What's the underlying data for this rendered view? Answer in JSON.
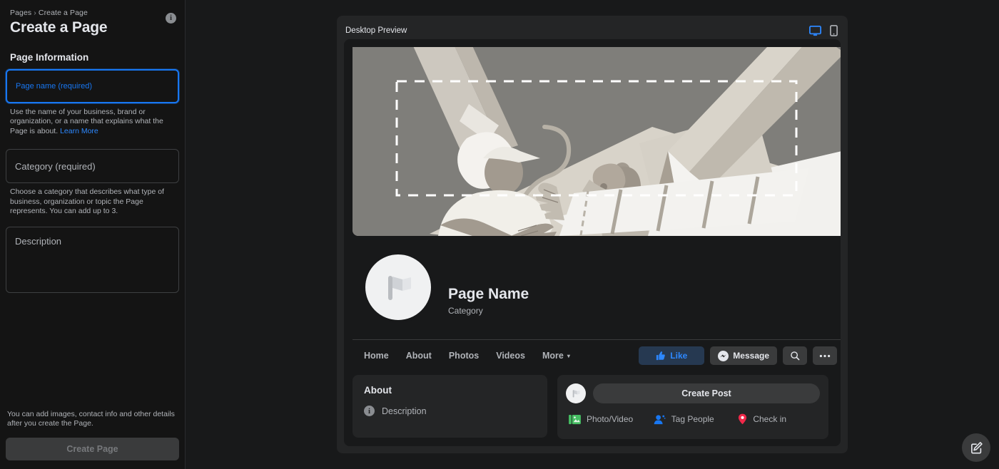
{
  "sidebar": {
    "breadcrumb": {
      "root": "Pages",
      "separator": "›",
      "current": "Create a Page"
    },
    "title": "Create a Page",
    "info_icon": "i",
    "section_title": "Page Information",
    "fields": [
      {
        "name": "page-name",
        "label": "Page name (required)",
        "value": "",
        "focused": true,
        "helper": "Use the name of your business, brand or organization, or a name that explains what the Page is about. ",
        "helper_link": "Learn More"
      },
      {
        "name": "category",
        "label": "Category (required)",
        "value": "",
        "focused": false,
        "helper": "Choose a category that describes what type of business, organization or topic the Page represents. You can add up to 3.",
        "helper_link": ""
      },
      {
        "name": "description",
        "label": "Description",
        "value": "",
        "focused": false,
        "helper": "",
        "helper_link": ""
      }
    ],
    "foot_note": "You can add images, contact info and other details after you create the Page.",
    "create_button": "Create Page"
  },
  "preview": {
    "title": "Desktop Preview",
    "devices": [
      {
        "name": "desktop",
        "active": true,
        "color": "#2d88ff"
      },
      {
        "name": "mobile",
        "active": false,
        "color": "#b0b3b8"
      }
    ],
    "page_name": "Page Name",
    "page_category": "Category",
    "nav_tabs": [
      {
        "label": "Home",
        "caret": ""
      },
      {
        "label": "About",
        "caret": ""
      },
      {
        "label": "Photos",
        "caret": ""
      },
      {
        "label": "Videos",
        "caret": ""
      },
      {
        "label": "More",
        "caret": "▾"
      }
    ],
    "actions": {
      "like": "Like",
      "message": "Message",
      "search_icon": "search-icon",
      "more_icon": "ellipsis-icon"
    },
    "about_card": {
      "heading": "About",
      "row_icon": "i",
      "row_label": "Description"
    },
    "post_card": {
      "placeholder": "Create Post",
      "actions": [
        {
          "label": "Photo/Video",
          "icon": "photo-video-icon",
          "color": "#45bd62"
        },
        {
          "label": "Tag People",
          "icon": "tag-people-icon",
          "color": "#1877f2"
        },
        {
          "label": "Check in",
          "icon": "check-in-icon",
          "color": "#f02849"
        }
      ]
    }
  },
  "fab": {
    "icon": "compose-icon"
  },
  "colors": {
    "background": "#18191a",
    "sidebar": "#141414",
    "panel": "#242526",
    "accent_blue": "#1877f2",
    "link_blue": "#2d88ff",
    "text_primary": "#e4e6eb",
    "text_secondary": "#b0b3b8",
    "cover_bg": "#7f7e7a"
  }
}
